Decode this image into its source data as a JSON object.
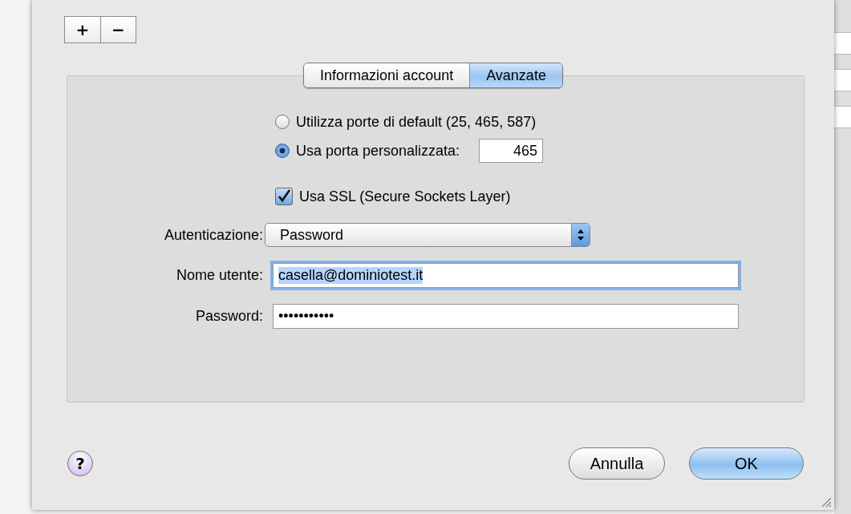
{
  "segment_buttons": [
    {
      "label": "+"
    },
    {
      "label": "−"
    }
  ],
  "tabs": [
    {
      "label": "Informazioni account",
      "selected": false
    },
    {
      "label": "Avanzate",
      "selected": true
    }
  ],
  "port_options": [
    {
      "label": "Utilizza porte di default (25, 465, 587)",
      "selected": false
    },
    {
      "label": "Usa porta personalizzata:",
      "selected": true,
      "port": "465"
    }
  ],
  "ssl": {
    "label": "Usa SSL (Secure Sockets Layer)",
    "checked": true
  },
  "authentication": {
    "label": "Autenticazione:",
    "value": "Password"
  },
  "username": {
    "label": "Nome utente:",
    "value": "casella@dominiotest.it",
    "text_selected": true
  },
  "password": {
    "label": "Password:",
    "value": "•••••••••••"
  },
  "help": {
    "label": "?"
  },
  "buttons": [
    {
      "label": "Annulla",
      "default": false
    },
    {
      "label": "OK",
      "default": true
    }
  ]
}
